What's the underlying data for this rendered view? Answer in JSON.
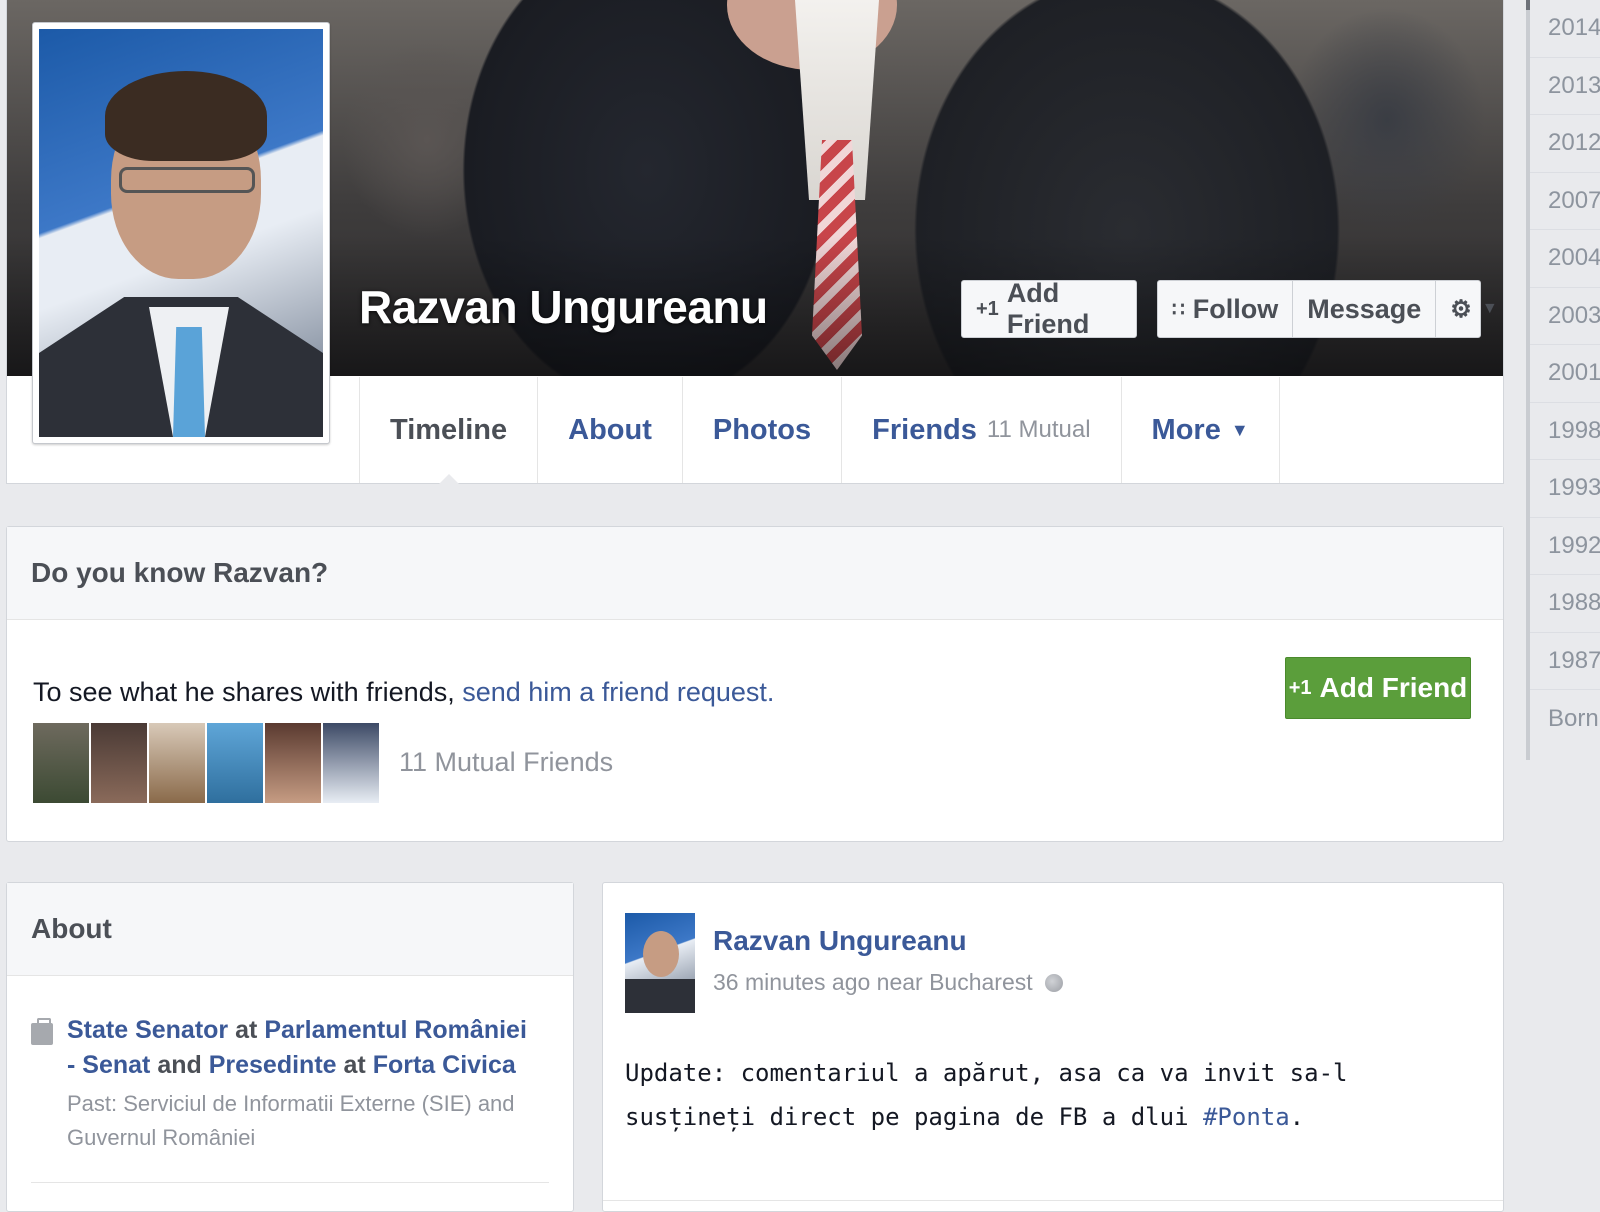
{
  "profile": {
    "name": "Razvan Ungureanu"
  },
  "cover_actions": {
    "add_friend": "Add Friend",
    "follow": "Follow",
    "message": "Message"
  },
  "tabs": [
    {
      "label": "Timeline"
    },
    {
      "label": "About"
    },
    {
      "label": "Photos"
    },
    {
      "label": "Friends",
      "sub": "11 Mutual"
    },
    {
      "label": "More"
    }
  ],
  "know_box": {
    "title": "Do you know Razvan?",
    "text": "To see what he shares with friends,",
    "link": "send him a friend request.",
    "add_friend": "Add Friend",
    "mutual": "11 Mutual Friends"
  },
  "about": {
    "title": "About",
    "role1": "State Senator",
    "at1": "at",
    "org1": "Parlamentul României - Senat",
    "and": "and",
    "role2": "Presedinte",
    "at2": "at",
    "org2": "Forta Civica",
    "past": "Past: Serviciul de Informatii Externe (SIE) and Guvernul României"
  },
  "post": {
    "author": "Razvan Ungureanu",
    "meta": "36 minutes ago near Bucharest",
    "text_before": "Update: comentariul a apărut, asa ca va invit sa-l susțineți direct pe pagina de FB a dlui ",
    "hashtag": "#Ponta",
    "text_after": "."
  },
  "years": [
    "2014",
    "2013",
    "2012",
    "2007",
    "2004",
    "2003",
    "2001",
    "1998",
    "1993",
    "1992",
    "1988",
    "1987",
    "Born"
  ],
  "icons": {
    "add_friend": "person-plus-icon",
    "follow": "rss-icon",
    "settings": "gear-icon",
    "dropdown": "caret-down-icon",
    "work": "briefcase-icon",
    "privacy": "globe-icon"
  },
  "colors": {
    "link": "#3b5998",
    "green_button": "#5b9e3b",
    "background": "#e9eaed"
  }
}
